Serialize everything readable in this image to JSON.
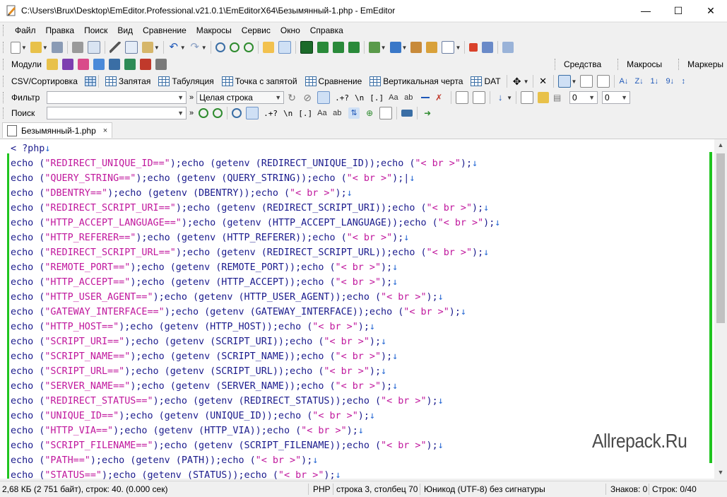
{
  "window": {
    "title": "C:\\Users\\Brux\\Desktop\\EmEditor.Professional.v21.0.1\\EmEditorX64\\Безымянный-1.php - EmEditor",
    "minimize": "—",
    "maximize": "☐",
    "close": "✕"
  },
  "menu": [
    "Файл",
    "Правка",
    "Поиск",
    "Вид",
    "Сравнение",
    "Макросы",
    "Сервис",
    "Окно",
    "Справка"
  ],
  "modules_bar": {
    "label": "Модули",
    "panels": [
      "Средства",
      "Макросы",
      "Маркеры"
    ]
  },
  "csv_bar": {
    "sort_label": "CSV/Сортировка",
    "modes": [
      "Запятая",
      "Табуляция",
      "Точка с запятой",
      "Сравнение",
      "Вертикальная черта",
      "DAT"
    ]
  },
  "filter_bar": {
    "label": "Фильтр",
    "filter_value": "",
    "mode_value": "Целая строка",
    "regex_label": ".+?",
    "newline_label": "\\n",
    "bracket_label": "[.]",
    "num1": "0",
    "num2": "0"
  },
  "search_bar": {
    "label": "Поиск",
    "search_value": "",
    "regex_label": ".+?",
    "newline_label": "\\n",
    "bracket_label": "[.]"
  },
  "tab": {
    "label": "Безымянный-1.php",
    "close": "×"
  },
  "editor": {
    "lines": [
      [
        [
          "kw",
          "< ?php"
        ],
        [
          "nl",
          "↓"
        ]
      ],
      [
        [
          "kw",
          "echo ("
        ],
        [
          "str",
          "\"REDIRECT_UNIQUE_ID==\""
        ],
        [
          "kw",
          ");echo (getenv (REDIRECT_UNIQUE_ID));echo ("
        ],
        [
          "str",
          "\"< br >\""
        ],
        [
          "kw",
          ");"
        ],
        [
          "nl",
          "↓"
        ]
      ],
      [
        [
          "kw",
          "echo ("
        ],
        [
          "str",
          "\"QUERY_STRING==\""
        ],
        [
          "kw",
          ");echo (getenv (QUERY_STRING));echo ("
        ],
        [
          "str",
          "\"< br >\""
        ],
        [
          "kw",
          ");|"
        ],
        [
          "nl",
          "↓"
        ]
      ],
      [
        [
          "kw",
          "echo ("
        ],
        [
          "str",
          "\"DBENTRY==\""
        ],
        [
          "kw",
          ");echo (getenv (DBENTRY));echo ("
        ],
        [
          "str",
          "\"< br >\""
        ],
        [
          "kw",
          ");"
        ],
        [
          "nl",
          "↓"
        ]
      ],
      [
        [
          "kw",
          "echo ("
        ],
        [
          "str",
          "\"REDIRECT_SCRIPT_URI==\""
        ],
        [
          "kw",
          ");echo (getenv (REDIRECT_SCRIPT_URI));echo ("
        ],
        [
          "str",
          "\"< br >\""
        ],
        [
          "kw",
          ");"
        ],
        [
          "nl",
          "↓"
        ]
      ],
      [
        [
          "kw",
          "echo ("
        ],
        [
          "str",
          "\"HTTP_ACCEPT_LANGUAGE==\""
        ],
        [
          "kw",
          ");echo (getenv (HTTP_ACCEPT_LANGUAGE));echo ("
        ],
        [
          "str",
          "\"< br >\""
        ],
        [
          "kw",
          ");"
        ],
        [
          "nl",
          "↓"
        ]
      ],
      [
        [
          "kw",
          "echo ("
        ],
        [
          "str",
          "\"HTTP_REFERER==\""
        ],
        [
          "kw",
          ");echo (getenv (HTTP_REFERER));echo ("
        ],
        [
          "str",
          "\"< br >\""
        ],
        [
          "kw",
          ");"
        ],
        [
          "nl",
          "↓"
        ]
      ],
      [
        [
          "kw",
          "echo ("
        ],
        [
          "str",
          "\"REDIRECT_SCRIPT_URL==\""
        ],
        [
          "kw",
          ");echo (getenv (REDIRECT_SCRIPT_URL));echo ("
        ],
        [
          "str",
          "\"< br >\""
        ],
        [
          "kw",
          ");"
        ],
        [
          "nl",
          "↓"
        ]
      ],
      [
        [
          "kw",
          "echo ("
        ],
        [
          "str",
          "\"REMOTE_PORT==\""
        ],
        [
          "kw",
          ");echo (getenv (REMOTE_PORT));echo ("
        ],
        [
          "str",
          "\"< br >\""
        ],
        [
          "kw",
          ");"
        ],
        [
          "nl",
          "↓"
        ]
      ],
      [
        [
          "kw",
          "echo ("
        ],
        [
          "str",
          "\"HTTP_ACCEPT==\""
        ],
        [
          "kw",
          ");echo (getenv (HTTP_ACCEPT));echo ("
        ],
        [
          "str",
          "\"< br >\""
        ],
        [
          "kw",
          ");"
        ],
        [
          "nl",
          "↓"
        ]
      ],
      [
        [
          "kw",
          "echo ("
        ],
        [
          "str",
          "\"HTTP_USER_AGENT==\""
        ],
        [
          "kw",
          ");echo (getenv (HTTP_USER_AGENT));echo ("
        ],
        [
          "str",
          "\"< br >\""
        ],
        [
          "kw",
          ");"
        ],
        [
          "nl",
          "↓"
        ]
      ],
      [
        [
          "kw",
          "echo ("
        ],
        [
          "str",
          "\"GATEWAY_INTERFACE==\""
        ],
        [
          "kw",
          ");echo (getenv (GATEWAY_INTERFACE));echo ("
        ],
        [
          "str",
          "\"< br >\""
        ],
        [
          "kw",
          ");"
        ],
        [
          "nl",
          "↓"
        ]
      ],
      [
        [
          "kw",
          "echo ("
        ],
        [
          "str",
          "\"HTTP_HOST==\""
        ],
        [
          "kw",
          ");echo (getenv (HTTP_HOST));echo ("
        ],
        [
          "str",
          "\"< br >\""
        ],
        [
          "kw",
          ");"
        ],
        [
          "nl",
          "↓"
        ]
      ],
      [
        [
          "kw",
          "echo ("
        ],
        [
          "str",
          "\"SCRIPT_URI==\""
        ],
        [
          "kw",
          ");echo (getenv (SCRIPT_URI));echo ("
        ],
        [
          "str",
          "\"< br >\""
        ],
        [
          "kw",
          ");"
        ],
        [
          "nl",
          "↓"
        ]
      ],
      [
        [
          "kw",
          "echo ("
        ],
        [
          "str",
          "\"SCRIPT_NAME==\""
        ],
        [
          "kw",
          ");echo (getenv (SCRIPT_NAME));echo ("
        ],
        [
          "str",
          "\"< br >\""
        ],
        [
          "kw",
          ");"
        ],
        [
          "nl",
          "↓"
        ]
      ],
      [
        [
          "kw",
          "echo ("
        ],
        [
          "str",
          "\"SCRIPT_URL==\""
        ],
        [
          "kw",
          ");echo (getenv (SCRIPT_URL));echo ("
        ],
        [
          "str",
          "\"< br >\""
        ],
        [
          "kw",
          ");"
        ],
        [
          "nl",
          "↓"
        ]
      ],
      [
        [
          "kw",
          "echo ("
        ],
        [
          "str",
          "\"SERVER_NAME==\""
        ],
        [
          "kw",
          ");echo (getenv (SERVER_NAME));echo ("
        ],
        [
          "str",
          "\"< br >\""
        ],
        [
          "kw",
          ");"
        ],
        [
          "nl",
          "↓"
        ]
      ],
      [
        [
          "kw",
          "echo ("
        ],
        [
          "str",
          "\"REDIRECT_STATUS==\""
        ],
        [
          "kw",
          ");echo (getenv (REDIRECT_STATUS));echo ("
        ],
        [
          "str",
          "\"< br >\""
        ],
        [
          "kw",
          ");"
        ],
        [
          "nl",
          "↓"
        ]
      ],
      [
        [
          "kw",
          "echo ("
        ],
        [
          "str",
          "\"UNIQUE_ID==\""
        ],
        [
          "kw",
          ");echo (getenv (UNIQUE_ID));echo ("
        ],
        [
          "str",
          "\"< br >\""
        ],
        [
          "kw",
          ");"
        ],
        [
          "nl",
          "↓"
        ]
      ],
      [
        [
          "kw",
          "echo ("
        ],
        [
          "str",
          "\"HTTP_VIA==\""
        ],
        [
          "kw",
          ");echo (getenv (HTTP_VIA));echo ("
        ],
        [
          "str",
          "\"< br >\""
        ],
        [
          "kw",
          ");"
        ],
        [
          "nl",
          "↓"
        ]
      ],
      [
        [
          "kw",
          "echo ("
        ],
        [
          "str",
          "\"SCRIPT_FILENAME==\""
        ],
        [
          "kw",
          ");echo (getenv (SCRIPT_FILENAME));echo ("
        ],
        [
          "str",
          "\"< br >\""
        ],
        [
          "kw",
          ");"
        ],
        [
          "nl",
          "↓"
        ]
      ],
      [
        [
          "kw",
          "echo ("
        ],
        [
          "str",
          "\"PATH==\""
        ],
        [
          "kw",
          ");echo (getenv (PATH));echo ("
        ],
        [
          "str",
          "\"< br >\""
        ],
        [
          "kw",
          ");"
        ],
        [
          "nl",
          "↓"
        ]
      ],
      [
        [
          "kw",
          "echo ("
        ],
        [
          "str",
          "\"STATUS==\""
        ],
        [
          "kw",
          ");echo (getenv (STATUS));echo ("
        ],
        [
          "str",
          "\"< br >\""
        ],
        [
          "kw",
          ");"
        ],
        [
          "nl",
          "↓"
        ]
      ]
    ]
  },
  "watermark": "Allrepack.Ru",
  "status": {
    "size": "2,68 КБ (2 751 байт), строк: 40. (0.000 сек)",
    "language": "PHP",
    "position": "строка 3, столбец 70",
    "encoding": "Юникод (UTF-8) без сигнатуры",
    "chars": "Знаков: 0",
    "lines": "Строк: 0/40"
  },
  "colors": {
    "keyword": "#1a1a8c",
    "string": "#c0179d",
    "newline_mark": "#2a6ad4",
    "modified_bar": "#1fc41f"
  }
}
